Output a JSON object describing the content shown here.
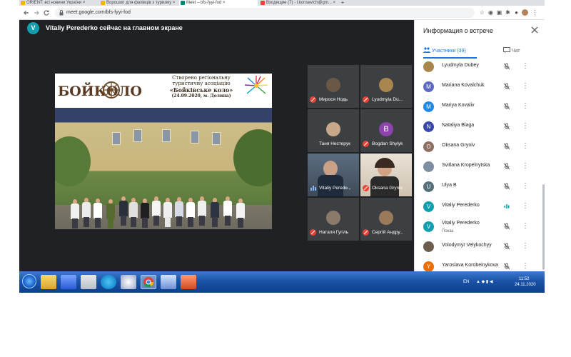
{
  "browser": {
    "tabs": [
      {
        "label": "ORIENT: всі новини України ×",
        "color": "#f4b400"
      },
      {
        "label": "Ворошоп для фахівців з туризму ×",
        "color": "#f4b400"
      },
      {
        "label": "Meet – bfs-fyyi-fod ×",
        "color": "#00897b",
        "active": true
      },
      {
        "label": "Входящие (7) - l.konsevich@gm... ×",
        "color": "#ea4335"
      }
    ],
    "new_tab": "+",
    "back_icon": "arrow-left",
    "forward_icon": "arrow-right",
    "reload_icon": "reload",
    "url": "meet.google.com/bfs-fyyi-fod"
  },
  "meet": {
    "presenter_initial": "V",
    "presenter_banner": "Vitaliy Perederko сейчас на главном экране",
    "slide": {
      "logo": "БОЙКОЛО",
      "caption_line1": "Створено регіональну",
      "caption_line2": "туристичну асоціацію",
      "caption_title": "«Бойківське коло»",
      "caption_date": "(24.09.2020, м. Долина)"
    },
    "tiles": [
      {
        "name": "Мирося Нодь",
        "initial": "",
        "color": "#6b5844"
      },
      {
        "name": "Lyudmyla Du...",
        "initial": "",
        "color": "#a8864e"
      },
      {
        "name": "Таня Нестерук",
        "initial": "",
        "color": "#c9a88a"
      },
      {
        "name": "Bogdan Shylyk",
        "initial": "B",
        "color": "#8e44ad"
      },
      {
        "name": "Vitaliy Perede...",
        "initial": "",
        "color": "#5a6b7a"
      },
      {
        "name": "Oksana Gryniv",
        "initial": "",
        "color": "#7a6a5a"
      },
      {
        "name": "Наталя Гугіль",
        "initial": "",
        "color": "#8a7a6a"
      },
      {
        "name": "Сергій Андру...",
        "initial": "",
        "color": "#9a7a5a"
      }
    ]
  },
  "panel": {
    "title": "Информация о встрече",
    "tab_participants": "Участники (39)",
    "tab_chat": "Чат",
    "participants": [
      {
        "name": "Lyudmyla Dubey",
        "initial": "",
        "color": "#a8864e",
        "sub": "",
        "mic": "muted"
      },
      {
        "name": "Mariana Kovalchuk",
        "initial": "M",
        "color": "#5c6bc0",
        "sub": "",
        "mic": "muted"
      },
      {
        "name": "Mariya Kovaliv",
        "initial": "M",
        "color": "#1e88e5",
        "sub": "",
        "mic": "muted"
      },
      {
        "name": "Nataliya Blaga",
        "initial": "N",
        "color": "#3949ab",
        "sub": "",
        "mic": "muted"
      },
      {
        "name": "Oksana Gryniv",
        "initial": "O",
        "color": "#8d6e63",
        "sub": "",
        "mic": "muted"
      },
      {
        "name": "Svitlana Kropelnytska",
        "initial": "",
        "color": "#7d8fa0",
        "sub": "",
        "mic": "muted"
      },
      {
        "name": "Ulya B",
        "initial": "U",
        "color": "#546e7a",
        "sub": "",
        "mic": "muted"
      },
      {
        "name": "Vitaliy Perederko",
        "initial": "V",
        "color": "#129eaf",
        "sub": "",
        "mic": "speaking"
      },
      {
        "name": "Vitaliy Perederko",
        "initial": "V",
        "color": "#129eaf",
        "sub": "Показ",
        "mic": "muted-off"
      },
      {
        "name": "Volodymyr Velykochyy",
        "initial": "",
        "color": "#6d5d4d",
        "sub": "",
        "mic": "muted"
      },
      {
        "name": "Yaroslava Korobeinykova",
        "initial": "Y",
        "color": "#ef6c00",
        "sub": "",
        "mic": "muted"
      }
    ]
  },
  "taskbar": {
    "lang": "EN",
    "time": "11:52",
    "date": "24.11.2020"
  }
}
